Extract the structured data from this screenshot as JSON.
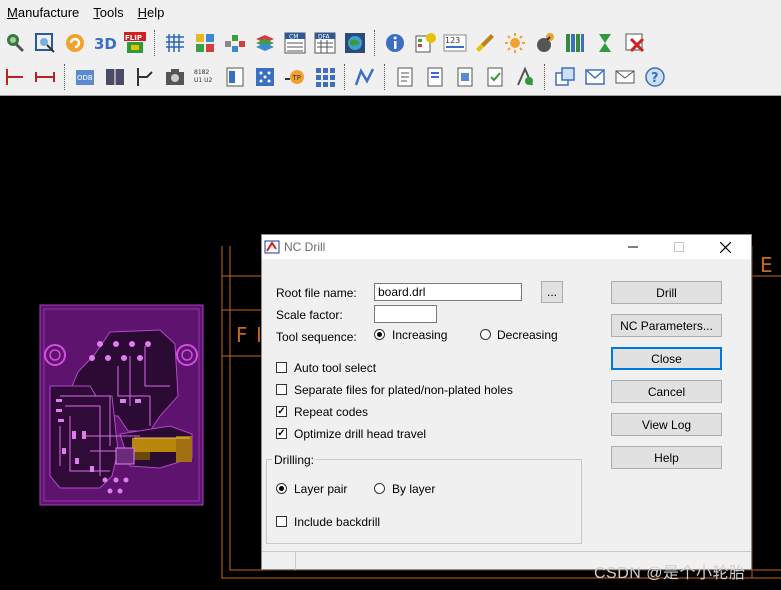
{
  "menu": {
    "items": [
      {
        "underlined": "M",
        "rest": "anufacture"
      },
      {
        "underlined": "T",
        "rest": "ools"
      },
      {
        "underlined": "H",
        "rest": "elp"
      }
    ]
  },
  "toolbar": {
    "row1_icons": [
      "wrench-icon",
      "zoom-fit-icon",
      "undo-icon",
      "3d-view-icon",
      "flip-view-icon",
      "grid-icon",
      "component-grid-icon",
      "placement-icon",
      "layer-stack-icon",
      "cm-icon",
      "dfa-icon",
      "globe-icon",
      "info-icon",
      "report-icon",
      "numbering-123-icon",
      "brush-icon",
      "sun-icon",
      "bomb-icon",
      "bars-icon",
      "hourglass-icon",
      "delete-image-icon"
    ],
    "row2_icons": [
      "dimension-icon",
      "measure-icon",
      "odb-export-icon",
      "book-icon",
      "cut-icon",
      "camera-icon",
      "pin-names-icon",
      "component-icon",
      "drill-dots-icon",
      "testpoint-icon",
      "array-icon",
      "route-icon",
      "doc-1-icon",
      "doc-2-icon",
      "doc-3-icon",
      "doc-4-icon",
      "doc-5-icon",
      "windows-icon",
      "send-icon",
      "mail-icon",
      "help-icon"
    ],
    "labels": {
      "cm": "CM",
      "dfa": "DFA",
      "flip": "FLIP",
      "num": "123",
      "odb": "ODB",
      "pins": "8182 U1 U2",
      "tp": "TP"
    }
  },
  "canvas": {
    "background": "#000000",
    "board_color": "#7a1a8c",
    "copper_color": "#b8860b",
    "outline_color": "#c8661e",
    "frame_letters": [
      "F",
      "I"
    ]
  },
  "dialog": {
    "title": "NC Drill",
    "root_file_label": "Root file name:",
    "root_file_value": "board.drl",
    "browse_label": "...",
    "scale_factor_label": "Scale factor:",
    "scale_factor_value": "",
    "tool_sequence_label": "Tool sequence:",
    "increasing_label": "Increasing",
    "decreasing_label": "Decreasing",
    "auto_tool_select_label": "Auto tool select",
    "auto_tool_select_checked": false,
    "separate_files_label": "Separate files for plated/non-plated holes",
    "separate_files_checked": false,
    "repeat_codes_label": "Repeat codes",
    "repeat_codes_checked": true,
    "optimize_label": "Optimize drill head travel",
    "optimize_checked": true,
    "drilling_group_label": "Drilling:",
    "layer_pair_label": "Layer pair",
    "by_layer_label": "By layer",
    "include_backdrill_label": "Include backdrill",
    "include_backdrill_checked": false,
    "buttons": {
      "drill": "Drill",
      "nc_params": "NC Parameters...",
      "close": "Close",
      "cancel": "Cancel",
      "view_log": "View Log",
      "help": "Help"
    }
  },
  "watermark": "CSDN @是个小轮胎"
}
